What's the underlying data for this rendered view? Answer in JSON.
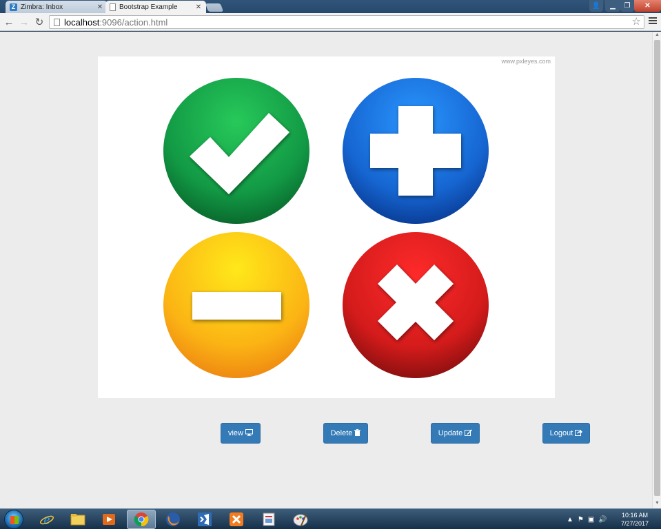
{
  "browser": {
    "tabs": [
      {
        "label": "Zimbra: Inbox",
        "favicon": "zimbra-icon",
        "active": false
      },
      {
        "label": "Bootstrap Example",
        "favicon": "page-icon",
        "active": true
      }
    ],
    "url_host": "localhost",
    "url_rest": ":9096/action.html"
  },
  "page": {
    "hero_image": {
      "watermark": "www.pxleyes.com",
      "icons": [
        "check-circle-icon",
        "plus-circle-icon",
        "minus-circle-icon",
        "x-circle-icon"
      ]
    },
    "buttons": [
      {
        "label": "view",
        "icon": "desktop-icon"
      },
      {
        "label": "Delete",
        "icon": "trash-icon"
      },
      {
        "label": "Update",
        "icon": "edit-icon"
      },
      {
        "label": "Logout",
        "icon": "share-icon"
      }
    ]
  },
  "taskbar": {
    "apps": [
      "internet-explorer-icon",
      "file-explorer-icon",
      "media-player-icon",
      "chrome-icon",
      "firefox-icon",
      "visual-studio-icon",
      "xampp-icon",
      "document-icon",
      "paint-icon"
    ],
    "time": "10:16 AM",
    "date": "7/27/2017"
  },
  "colors": {
    "button_primary": "#337ab7",
    "check_green": "#1aa64b",
    "plus_blue": "#1a7be0",
    "minus_yellow": "#fbc40d",
    "x_red": "#e41e1e"
  }
}
